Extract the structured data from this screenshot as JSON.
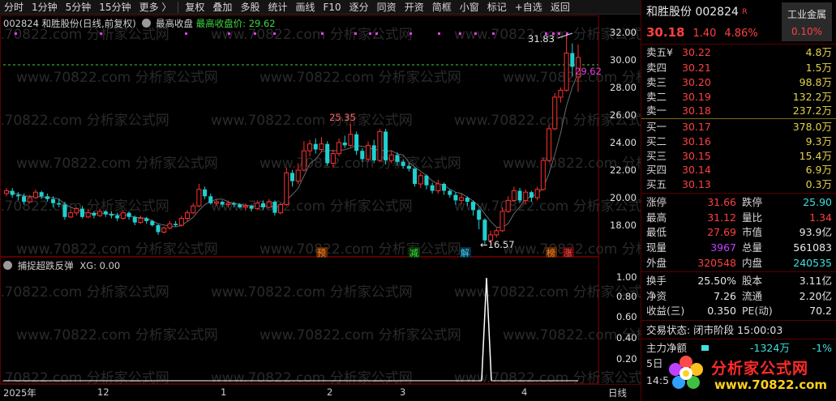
{
  "toolbar": {
    "items": [
      "分时",
      "1分钟",
      "5分钟",
      "15分钟",
      "更多 〉",
      "复权",
      "叠加",
      "多股",
      "统计",
      "画线",
      "F10",
      "逐分",
      "同资",
      "开资",
      "简框",
      "小窗",
      "标记",
      "+自选",
      "返回"
    ]
  },
  "chart": {
    "code": "002824",
    "name": "和胜股份",
    "period": "(日线,前复权)",
    "indicator": "最高收盘",
    "indicator_text": "最高收盘价: 29.62",
    "last_close_label": "29.62",
    "high_label": "31.83",
    "peak_label": "25.35",
    "low_label": "16.57",
    "y_axis": [
      "32.00",
      "30.00",
      "28.00",
      "26.00",
      "24.00",
      "22.00",
      "20.00",
      "18.00"
    ],
    "event_markers": [
      "预",
      "减",
      "解",
      "榜",
      "涨"
    ],
    "watermark": "www.70822.com 分析家公式网",
    "colors": {
      "up": "#ff3030",
      "down": "#20d0d0",
      "ma": "#e0e0e0",
      "dash": "#40d040",
      "accent": "#e040e0"
    }
  },
  "sub_chart": {
    "title": "捕捉超跌反弹",
    "xg_text": "XG: 0.00",
    "y_axis": [
      "1.00",
      "0.80",
      "0.60",
      "0.40",
      "0.20"
    ]
  },
  "date_axis": {
    "labels": [
      "2025年",
      "12",
      "1",
      "2",
      "3",
      "4"
    ],
    "period_label": "日线"
  },
  "quote": {
    "name_code": "和胜股份 002824",
    "r_mark": "R",
    "industry": "工业金属",
    "price": "30.18",
    "change": "1.40",
    "change_pct": "4.86%",
    "industry_pct": "0.10%",
    "asks": [
      {
        "label": "卖五",
        "price": "30.22",
        "vol": "4.8万",
        "mark": "¥"
      },
      {
        "label": "卖四",
        "price": "30.21",
        "vol": "1.5万"
      },
      {
        "label": "卖三",
        "price": "30.20",
        "vol": "98.8万"
      },
      {
        "label": "卖二",
        "price": "30.19",
        "vol": "132.2万"
      },
      {
        "label": "卖一",
        "price": "30.18",
        "vol": "237.2万"
      }
    ],
    "bids": [
      {
        "label": "买一",
        "price": "30.17",
        "vol": "378.0万"
      },
      {
        "label": "买二",
        "price": "30.16",
        "vol": "9.3万"
      },
      {
        "label": "买三",
        "price": "30.15",
        "vol": "15.4万"
      },
      {
        "label": "买四",
        "price": "30.14",
        "vol": "6.9万"
      },
      {
        "label": "买五",
        "price": "30.13",
        "vol": "0.3万"
      }
    ],
    "stats": [
      {
        "l1": "涨停",
        "v1": "31.66",
        "l2": "跌停",
        "v2": "25.90"
      },
      {
        "l1": "最高",
        "v1": "31.12",
        "l2": "量比",
        "v2": "1.34"
      },
      {
        "l1": "最低",
        "v1": "27.69",
        "l2": "市值",
        "v2": "93.9亿"
      },
      {
        "l1": "现量",
        "v1": "3967",
        "l2": "总量",
        "v2": "561083"
      },
      {
        "l1": "外盘",
        "v1": "320548",
        "l2": "内盘",
        "v2": "240535"
      }
    ],
    "stats2": [
      {
        "l1": "换手",
        "v1": "25.50%",
        "l2": "股本",
        "v2": "3.11亿"
      },
      {
        "l1": "净资",
        "v1": "7.26",
        "l2": "流通",
        "v2": "2.20亿"
      },
      {
        "l1": "收益(三)",
        "v1": "0.350",
        "l2": "PE(动)",
        "v2": "70.2"
      }
    ],
    "trade_status": "交易状态: 闭市阶段 15:00:03",
    "main_flow_label": "主力净额",
    "main_flow_value": "-1324万",
    "main_flow_pct": "-1%",
    "row5": "5日",
    "time_partial": "14:5",
    "logo_text": "分析家公式网",
    "logo_url": "www.70822.com"
  }
}
